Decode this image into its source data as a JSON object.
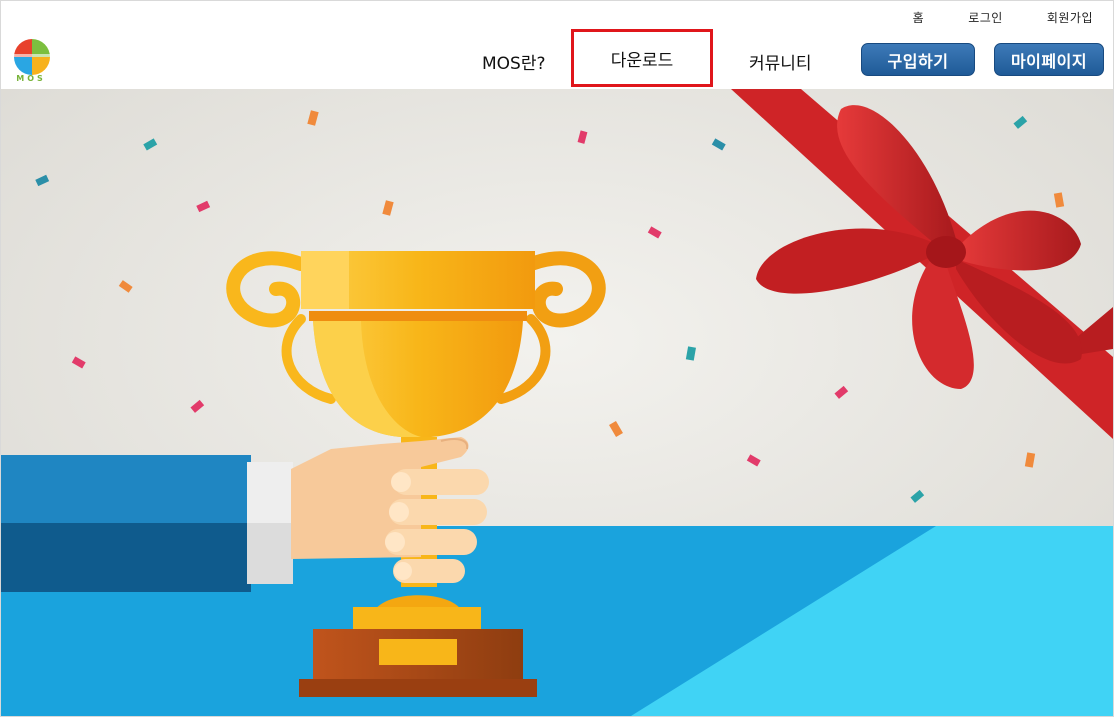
{
  "util_links": {
    "home": "홈",
    "login": "로그인",
    "signup": "회원가입"
  },
  "logo": {
    "text": "MOS"
  },
  "nav": {
    "about": "MOS란?",
    "download": "다운로드",
    "community": "커뮤니티",
    "buy": "구입하기",
    "mypage": "마이페이지"
  },
  "colors": {
    "highlight_border": "#e0161b",
    "button_blue": "#2a68a8",
    "table_blue": "#1aa3dd",
    "table_light": "#40d3f5",
    "sleeve": "#176fa6",
    "trophy_gold": "#f6b318",
    "ribbon_red": "#d5272a"
  }
}
